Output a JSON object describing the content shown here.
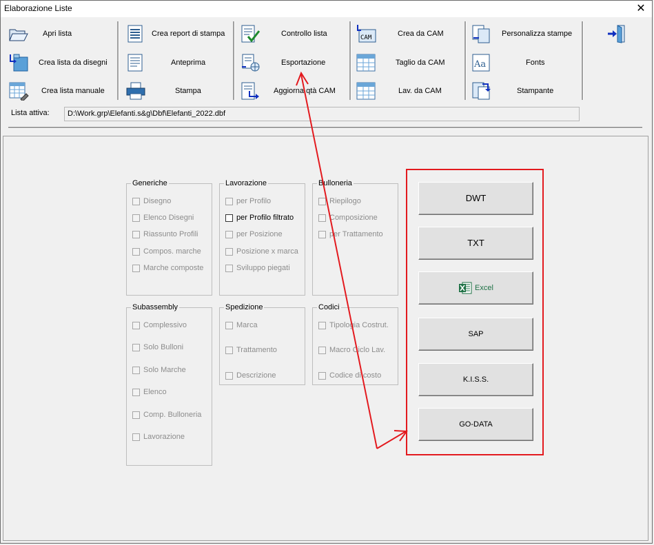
{
  "window": {
    "title": "Elaborazione Liste",
    "close_glyph": "✕"
  },
  "toolbar": {
    "col1": [
      {
        "label": "Apri lista",
        "icon": "folder-open-icon"
      },
      {
        "label": "Crea lista da disegni",
        "icon": "folder-arrow-icon"
      },
      {
        "label": "Crea lista manuale",
        "icon": "grid-pencil-icon"
      }
    ],
    "col2": [
      {
        "label": "Crea report di stampa",
        "icon": "report-list-icon"
      },
      {
        "label": "Anteprima",
        "icon": "document-icon"
      },
      {
        "label": "Stampa",
        "icon": "printer-icon"
      }
    ],
    "col3": [
      {
        "label": "Controllo lista",
        "icon": "document-check-icon"
      },
      {
        "label": "Esportazione",
        "icon": "document-globe-icon"
      },
      {
        "label": "Aggiorna qtà CAM",
        "icon": "document-arrow-icon"
      }
    ],
    "col4": [
      {
        "label": "Crea da CAM",
        "icon": "cam-icon"
      },
      {
        "label": "Taglio da CAM",
        "icon": "grid-icon"
      },
      {
        "label": "Lav. da CAM",
        "icon": "grid-icon"
      }
    ],
    "col5": [
      {
        "label": "Personalizza stampe",
        "icon": "copy-docs-icon"
      },
      {
        "label": "Fonts",
        "icon": "font-icon"
      },
      {
        "label": "Stampante",
        "icon": "printer-arrow-icon"
      }
    ],
    "exit_icon": "exit-door-icon"
  },
  "lista": {
    "label": "Lista attiva:",
    "value": "D:\\Work.grp\\Elefanti.s&g\\Dbf\\Elefanti_2022.dbf"
  },
  "groups": {
    "generiche": {
      "title": "Generiche",
      "items": [
        "Disegno",
        "Elenco Disegni",
        "Riassunto Profili",
        "Compos. marche",
        "Marche composte"
      ]
    },
    "lavorazione": {
      "title": "Lavorazione",
      "items": [
        "per Profilo",
        "per Profilo filtrato",
        "per Posizione",
        "Posizione x marca",
        "Sviluppo piegati"
      ]
    },
    "bulloneria": {
      "title": "Bulloneria",
      "items": [
        "Riepilogo",
        "Composizione",
        "per Trattamento"
      ]
    },
    "subassembly": {
      "title": "Subassembly",
      "items": [
        "Complessivo",
        "Solo Bulloni",
        "Solo Marche",
        "Elenco",
        "Comp. Bulloneria",
        "Lavorazione"
      ]
    },
    "spedizione": {
      "title": "Spedizione",
      "items": [
        "Marca",
        "Trattamento",
        "Descrizione"
      ]
    },
    "codici": {
      "title": "Codici",
      "items": [
        "Tipologia Costrut.",
        "Macro Ciclo Lav.",
        "Codice di costo"
      ]
    }
  },
  "export_buttons": [
    "DWT",
    "TXT",
    "Excel",
    "SAP",
    "K.I.S.S.",
    "GO-DATA"
  ],
  "colors": {
    "annotation_red": "#e3191e",
    "excel_green": "#1e7145"
  }
}
